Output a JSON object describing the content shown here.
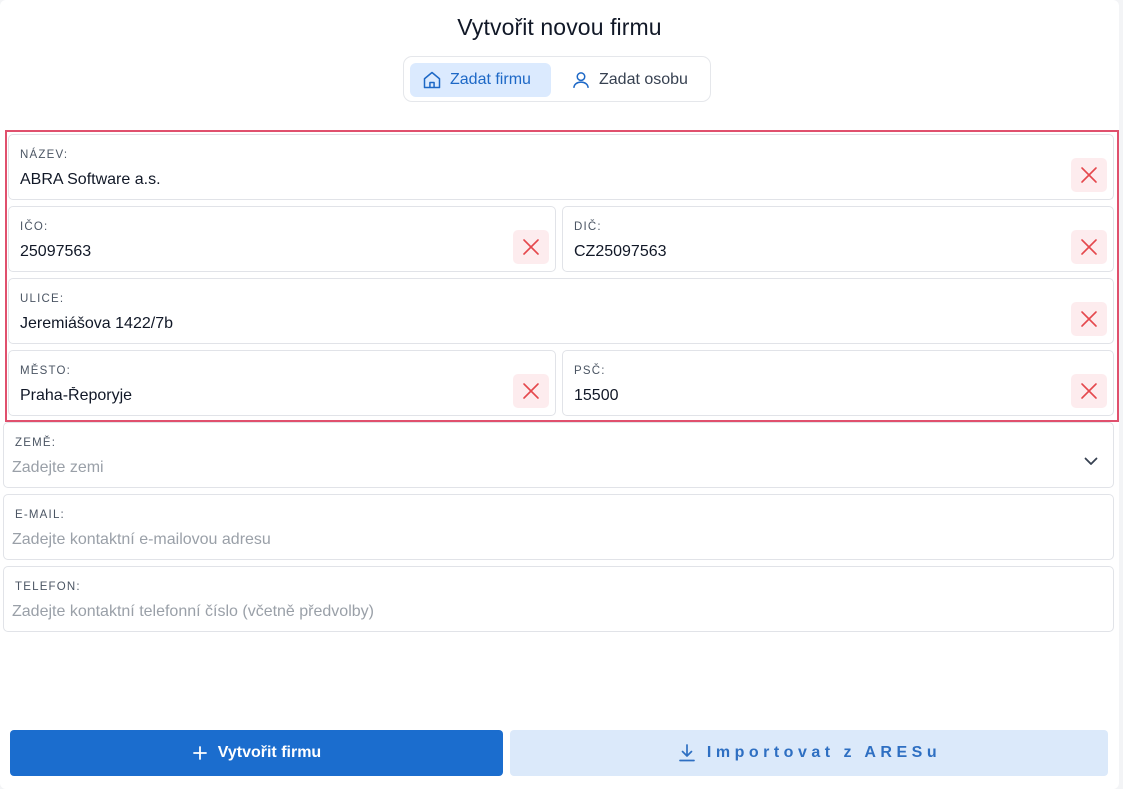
{
  "page": {
    "title": "Vytvořit novou firmu"
  },
  "segment": {
    "company_label": "Zadat firmu",
    "company_icon": "home-icon",
    "person_label": "Zadat osobu",
    "person_icon": "user-icon"
  },
  "fields": {
    "nazev": {
      "label": "NÁZEV:",
      "value": "ABRA Software a.s."
    },
    "ico": {
      "label": "IČO:",
      "value": "25097563"
    },
    "dic": {
      "label": "DIČ:",
      "value": "CZ25097563"
    },
    "ulice": {
      "label": "ULICE:",
      "value": "Jeremiášova 1422/7b"
    },
    "mesto": {
      "label": "MĚSTO:",
      "value": "Praha-Řeporyje"
    },
    "psc": {
      "label": "PSČ:",
      "value": "15500"
    },
    "zeme": {
      "label": "ZEMĚ:",
      "value": "",
      "placeholder": "Zadejte zemi"
    },
    "email": {
      "label": "E-MAIL:",
      "value": "",
      "placeholder": "Zadejte kontaktní e-mailovou adresu"
    },
    "telefon": {
      "label": "TELEFON:",
      "value": "",
      "placeholder": "Zadejte kontaktní telefonní číslo (včetně předvolby)"
    }
  },
  "actions": {
    "create_label": "Vytvořit firmu",
    "import_label": "Importovat z ARESu"
  },
  "colors": {
    "primary": "#1b6dce",
    "primary_light": "#dbe9fa",
    "highlight_border": "#e0506d",
    "clear_bg": "#fdecee",
    "clear_icon": "#e5484d"
  }
}
